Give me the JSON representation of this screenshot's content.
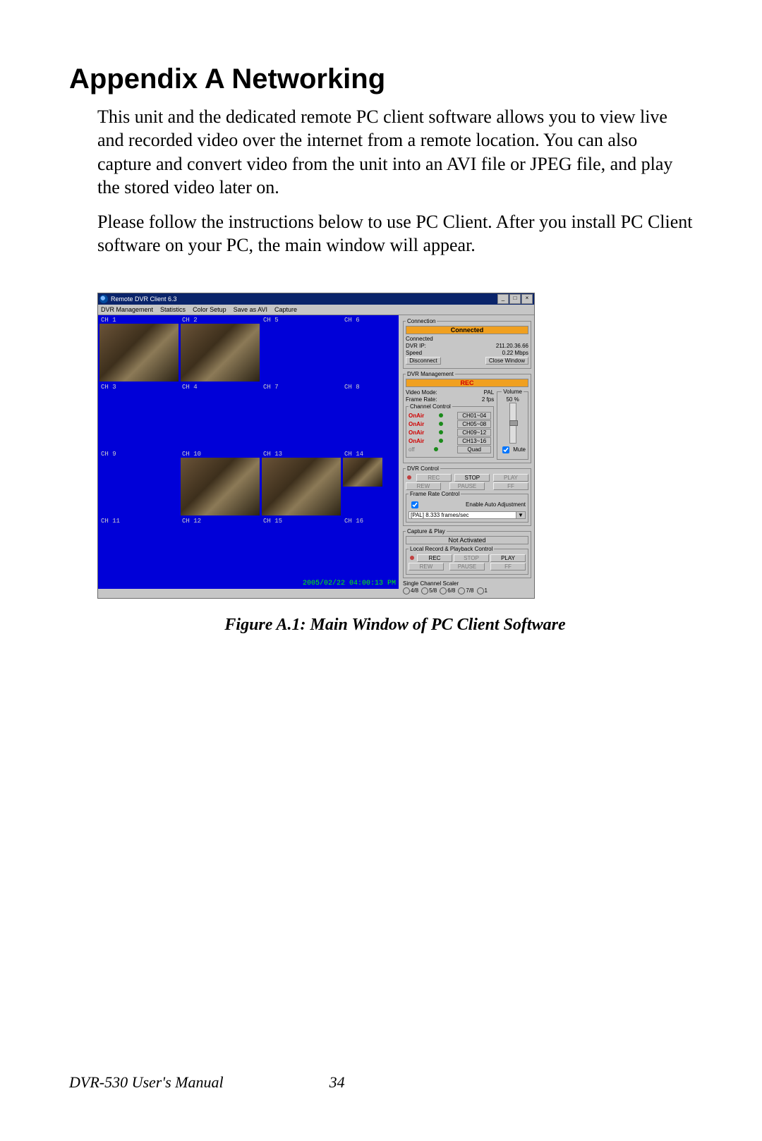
{
  "heading": "Appendix A  Networking",
  "para1": "This unit and the dedicated remote PC client software allows you to view live and recorded video over the internet from a remote location. You can also capture and convert video from the unit into an AVI file or JPEG file, and play the stored video later on.",
  "para2": "Please follow the instructions below to use PC Client. After you install PC Client software on your PC, the main window will appear.",
  "app": {
    "title": "Remote DVR Client 6.3",
    "menu": [
      "DVR Management",
      "Statistics",
      "Color Setup",
      "Save as AVI",
      "Capture"
    ],
    "channels": [
      "CH 1",
      "CH 2",
      "CH 5",
      "CH 6",
      "CH 3",
      "CH 4",
      "CH 7",
      "CH 8",
      "CH 9",
      "CH 10",
      "CH 13",
      "CH 14",
      "CH 11",
      "CH 12",
      "CH 15",
      "CH 16"
    ],
    "timestamp": "2005/02/22 04:00:13 PM"
  },
  "conn": {
    "legend": "Connection",
    "status": "Connected",
    "l1": "Connected",
    "l2a": "DVR IP:",
    "l2b": "211.20.36.66",
    "l3a": "Speed",
    "l3b": "0.22 Mbps",
    "disconnect": "Disconnect",
    "close": "Close Window"
  },
  "mgmt": {
    "legend": "DVR Management",
    "rec": "REC",
    "vm_a": "Video Mode:",
    "vm_b": "PAL",
    "fr_a": "Frame Rate:",
    "fr_b": "2 fps",
    "vol_legend": "Volume",
    "vol_val": "50 %",
    "cc_legend": "Channel Control",
    "onair": "OnAir",
    "off": "off",
    "ch": [
      "CH01~04",
      "CH05~08",
      "CH09~12",
      "CH13~16",
      "Quad"
    ],
    "mute": "Mute"
  },
  "dvrc": {
    "legend": "DVR Control",
    "btns": [
      "REC",
      "STOP",
      "PLAY",
      "REW",
      "PAUSE",
      "FF"
    ],
    "frc_legend": "Frame Rate Control",
    "auto": "Enable Auto Adjustment",
    "rate": "[PAL] 8.333 frames/sec"
  },
  "cap": {
    "legend": "Capture & Play",
    "status": "Not Activated",
    "lr_legend": "Local Record & Playback Control",
    "btns": [
      "REC",
      "STOP",
      "PLAY",
      "REW",
      "PAUSE",
      "FF"
    ]
  },
  "scaler": {
    "legend": "Single Channel Scaler",
    "opts": [
      "4/8",
      "5/8",
      "6/8",
      "7/8",
      "1"
    ]
  },
  "figcaption": "Figure A.1: Main Window of PC Client Software",
  "footer_left": "DVR-530 User's Manual",
  "footer_page": "34"
}
